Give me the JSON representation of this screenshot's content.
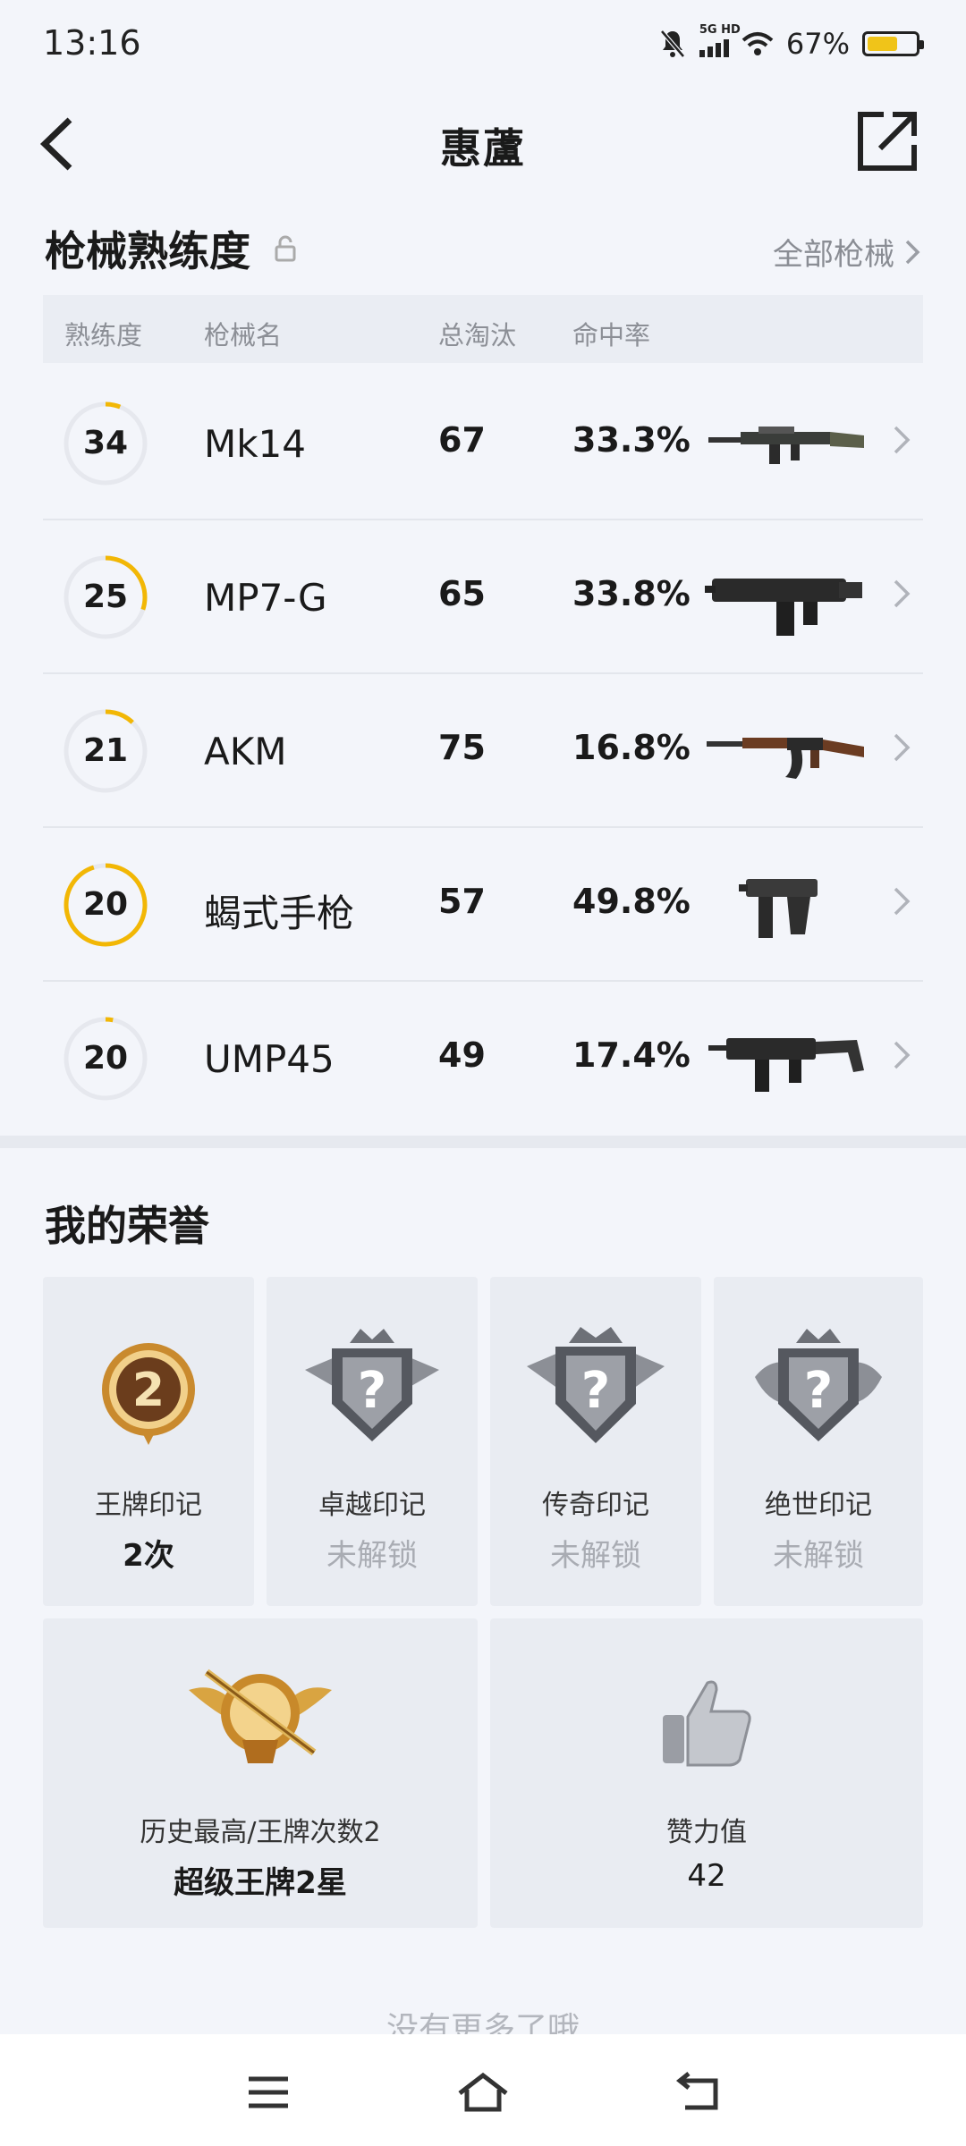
{
  "status": {
    "time": "13:16",
    "network": "5G HD",
    "battery": "67%",
    "battery_level": 0.67
  },
  "header": {
    "title": "惠蘆"
  },
  "mastery": {
    "title": "枪械熟练度",
    "all_link": "全部枪械",
    "columns": [
      "熟练度",
      "枪械名",
      "总淘汰",
      "命中率"
    ],
    "rows": [
      {
        "level": "34",
        "progress": 0.06,
        "name": "Mk14",
        "kills": "67",
        "rate": "33.3%",
        "icon": "sniper-rifle-icon"
      },
      {
        "level": "25",
        "progress": 0.3,
        "name": "MP7-G",
        "kills": "65",
        "rate": "33.8%",
        "icon": "smg-icon"
      },
      {
        "level": "21",
        "progress": 0.12,
        "name": "AKM",
        "kills": "75",
        "rate": "16.8%",
        "icon": "assault-rifle-icon"
      },
      {
        "level": "20",
        "progress": 0.95,
        "name": "蝎式手枪",
        "kills": "57",
        "rate": "49.8%",
        "icon": "pistol-icon"
      },
      {
        "level": "20",
        "progress": 0.03,
        "name": "UMP45",
        "kills": "49",
        "rate": "17.4%",
        "icon": "smg-icon"
      }
    ]
  },
  "honor": {
    "title": "我的荣誉",
    "badges": [
      {
        "label": "王牌印记",
        "value": "2次",
        "badge_number": "2",
        "locked": false
      },
      {
        "label": "卓越印记",
        "value": "未解锁",
        "locked": true
      },
      {
        "label": "传奇印记",
        "value": "未解锁",
        "locked": true
      },
      {
        "label": "绝世印记",
        "value": "未解锁",
        "locked": true
      }
    ],
    "history": {
      "label": "历史最高/王牌次数2",
      "value": "超级王牌2星"
    },
    "effort": {
      "label": "赞力值",
      "value": "42"
    }
  },
  "footer": {
    "text": "没有更多了哦"
  },
  "colors": {
    "accent": "#f2b705",
    "bg": "#f3f5fa"
  }
}
